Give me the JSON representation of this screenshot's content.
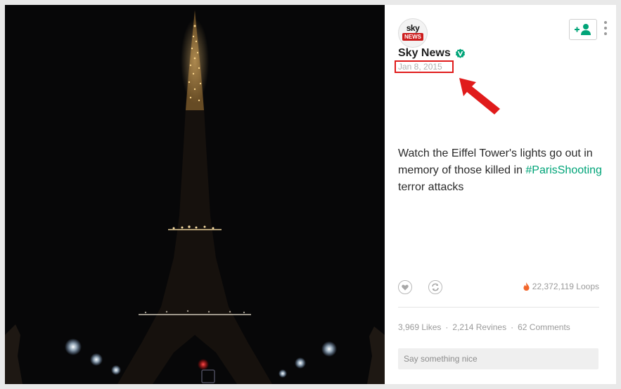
{
  "post": {
    "author": {
      "logo_top": "sky",
      "logo_bottom": "NEWS",
      "name": "Sky News",
      "date": "Jan 8, 2015"
    },
    "caption": {
      "text_before": "Watch the Eiffel Tower's lights go out in memory of those killed in ",
      "hashtag": "#ParisShooting",
      "text_after": " terror attacks"
    },
    "loops": "22,372,119 Loops",
    "stats": {
      "likes": "3,969 Likes",
      "revines": "2,214 Revines",
      "comments": "62 Comments",
      "separator": "·"
    },
    "comment_placeholder": "Say something nice"
  },
  "colors": {
    "accent_green": "#00a478",
    "annotation_red": "#e01b1b",
    "loops_flame": "#f2662b"
  },
  "icons": [
    "verified-icon",
    "follow-user-icon",
    "more-icon",
    "like-icon",
    "revine-icon",
    "loops-flame-icon",
    "arrow-icon"
  ]
}
